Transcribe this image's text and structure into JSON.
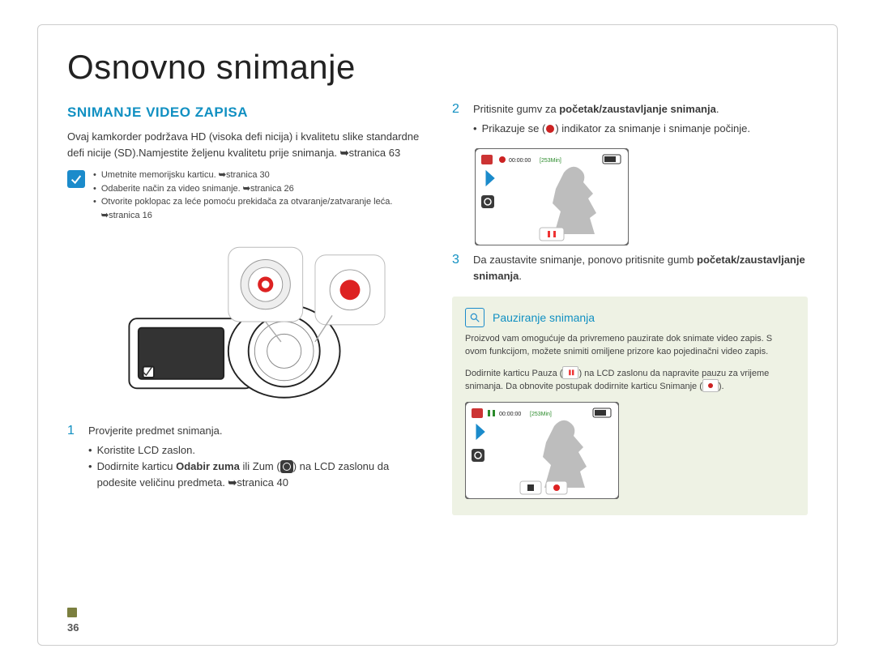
{
  "page": {
    "title": "Osnovno snimanje",
    "number": "36"
  },
  "left": {
    "heading": "SNIMANJE VIDEO ZAPISA",
    "intro_a": "Ovaj kamkorder podržava HD (visoka defi nicija) i kvalitetu slike standardne defi nicije (SD).Namjestite željenu kvalitetu prije snimanja. ",
    "intro_ref": "stranica 63",
    "precheck": {
      "items": [
        {
          "text": "Umetnite memorijsku karticu. ",
          "ref": "stranica 30"
        },
        {
          "text": "Odaberite način za video snimanje. ",
          "ref": "stranica 26"
        },
        {
          "text": "Otvorite poklopac za leće pomoću prekidača za otvaranje/zatvaranje leća. ",
          "ref": "stranica 16"
        }
      ]
    },
    "step1": {
      "num": "1",
      "text": "Provjerite predmet snimanja.",
      "sub1": "Koristite LCD zaslon.",
      "sub2a": "Dodirnite karticu ",
      "sub2b": "Odabir zuma",
      "sub2c": " ili Zum (",
      "sub2d": ") na LCD zaslonu da podesite veličinu predmeta. ",
      "sub2ref": "stranica 40"
    }
  },
  "right": {
    "step2": {
      "num": "2",
      "text_a": "Pritisnite gumv za ",
      "text_b": "početak/zaustavljanje snimanja",
      "text_c": ".",
      "sub_a": "Prikazuje se (",
      "sub_b": ") indikator za snimanje i snimanje počinje."
    },
    "step3": {
      "num": "3",
      "text_a": "Da zaustavite snimanje, ponovo pritisnite gumb ",
      "text_b": "početak/zaustavljanje snimanja",
      "text_c": "."
    },
    "callout": {
      "title": "Pauziranje snimanja",
      "p1": "Proizvod vam omogućuje da privremeno pauzirate dok snimate video zapis. S ovom funkcijom, možete snimiti omiljene prizore kao pojedinačni video zapis.",
      "p2a": "Dodirnite karticu Pauza (",
      "p2b": ") na LCD zaslonu da napravite pauzu za vrijeme snimanja. Da obnovite postupak dodirnite karticu Snimanje (",
      "p2c": ")."
    },
    "thumb_top": {
      "time": "00:00:00",
      "remain": "[253Min]"
    },
    "thumb_bottom": {
      "time": "00:00:00",
      "remain": "[253Min]"
    }
  }
}
